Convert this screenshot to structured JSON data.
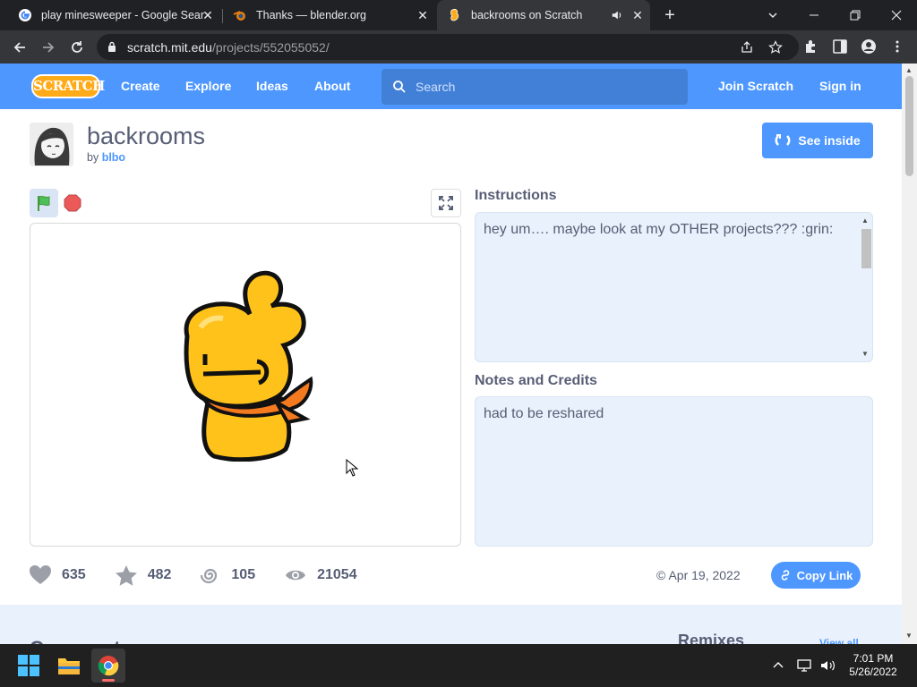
{
  "browser": {
    "tabs": [
      {
        "title": "play minesweeper - Google Sear",
        "icon": "google-favicon"
      },
      {
        "title": "Thanks — blender.org",
        "icon": "blender-favicon"
      },
      {
        "title": "backrooms on Scratch",
        "icon": "scratch-favicon",
        "active": true
      }
    ],
    "new_tab": "+",
    "url_host": "scratch.mit.edu",
    "url_path": "/projects/552055052/"
  },
  "scratch_nav": {
    "logo": "SCRATCH",
    "links": [
      "Create",
      "Explore",
      "Ideas",
      "About"
    ],
    "search_placeholder": "Search",
    "join": "Join Scratch",
    "signin": "Sign in",
    "color": "#4d97ff"
  },
  "project": {
    "title": "backrooms",
    "by": "by",
    "author": "blbo",
    "see_inside": "See inside",
    "instructions_heading": "Instructions",
    "instructions": "hey um…. maybe look at my OTHER projects??? :grin:",
    "notes_heading": "Notes and Credits",
    "notes": "had to be reshared",
    "stats": {
      "loves": "635",
      "favorites": "482",
      "remixes": "105",
      "views": "21054"
    },
    "shared_date": "Apr 19, 2022",
    "copy_link": "Copy Link"
  },
  "lower": {
    "comments": "Comments",
    "remixes": "Remixes",
    "view_all": "View all"
  },
  "taskbar": {
    "time": "7:01 PM",
    "date": "5/26/2022"
  }
}
